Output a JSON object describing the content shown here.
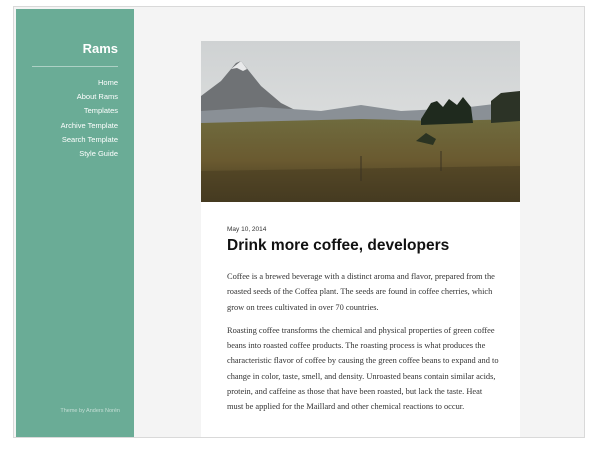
{
  "sidebar": {
    "site_title": "Rams",
    "nav": [
      "Home",
      "About Rams",
      "Templates",
      "Archive Template",
      "Search Template",
      "Style Guide"
    ],
    "credit": "Theme by Anders Norén",
    "color": "#6aac96"
  },
  "post": {
    "date": "May 10, 2014",
    "title": "Drink more coffee, developers",
    "paragraphs": [
      "Coffee is a brewed beverage with a distinct aroma and flavor, prepared from the roasted seeds of the Coffea plant. The seeds are found in coffee cherries, which grow on trees cultivated in over 70 countries.",
      "Roasting coffee transforms the chemical and physical properties of green coffee beans into roasted coffee products. The roasting process is what produces the characteristic flavor of coffee by causing the green coffee beans to expand and to change in color, taste, smell, and density. Unroasted beans contain similar acids, protein, and caffeine as those that have been roasted, but lack the taste. Heat must be applied for the Maillard and other chemical reactions to occur."
    ]
  }
}
